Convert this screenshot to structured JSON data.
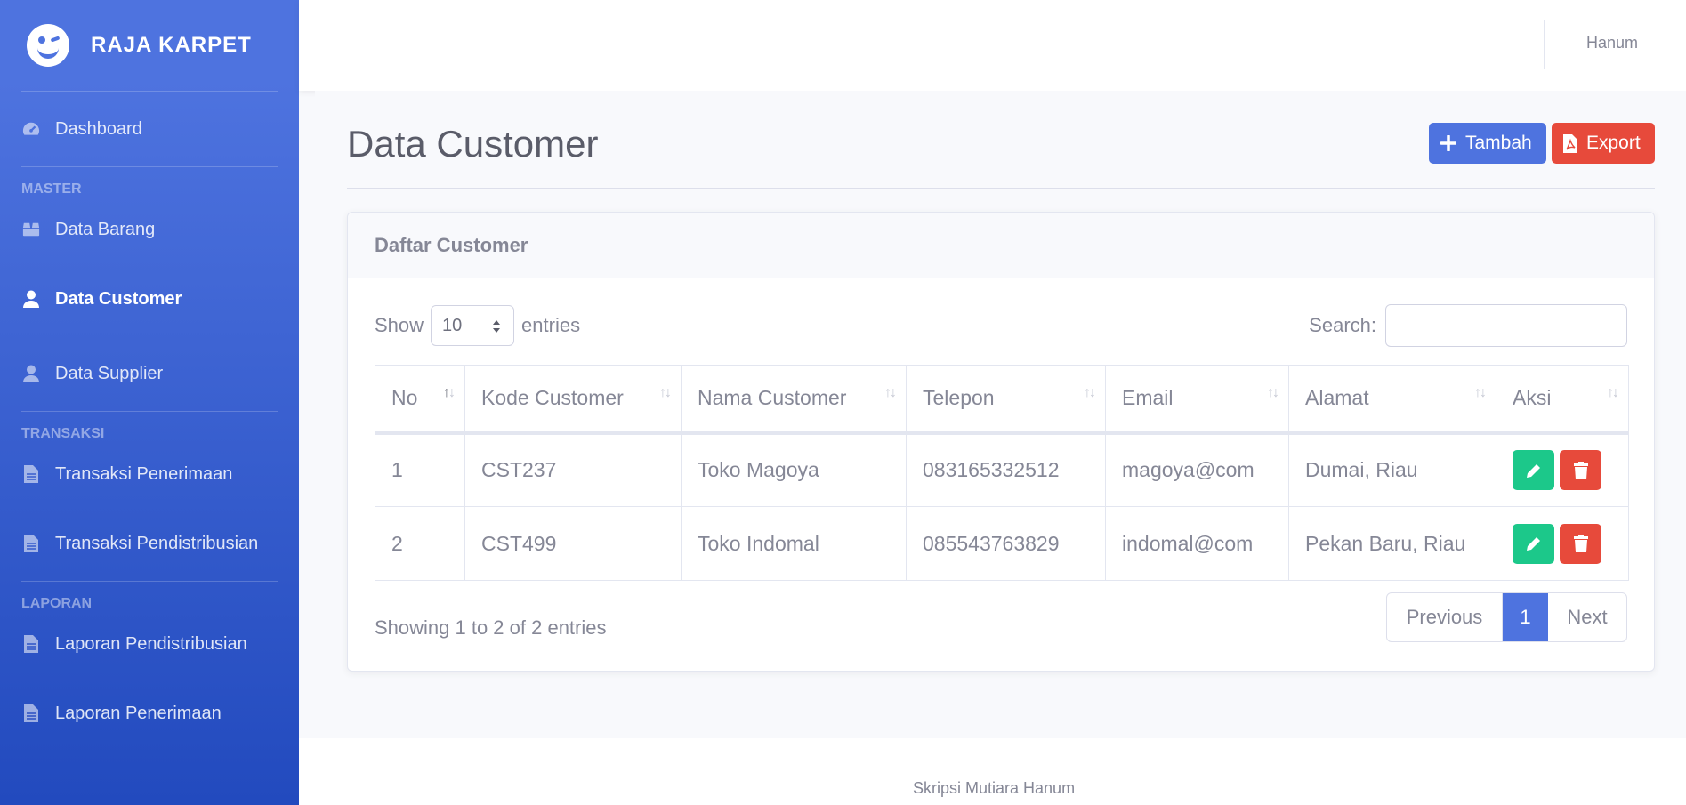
{
  "brand": {
    "name": "RAJA KARPET",
    "icon": "laugh-wink-icon"
  },
  "sidebar": {
    "dashboard": "Dashboard",
    "heading_master": "MASTER",
    "data_barang": "Data Barang",
    "data_customer": "Data Customer",
    "data_supplier": "Data Supplier",
    "heading_transaksi": "TRANSAKSI",
    "transaksi_penerimaan": "Transaksi Penerimaan",
    "transaksi_pendistribusian": "Transaksi Pendistribusian",
    "heading_laporan": "LAPORAN",
    "laporan_pendistribusian": "Laporan Pendistribusian",
    "laporan_penerimaan": "Laporan Penerimaan"
  },
  "topbar": {
    "user": "Hanum"
  },
  "page": {
    "title": "Data Customer",
    "btn_tambah": "Tambah",
    "btn_export": "Export"
  },
  "card": {
    "title": "Daftar Customer",
    "show_label": "Show",
    "entries_label": "entries",
    "length_value": "10",
    "search_label": "Search:",
    "search_value": ""
  },
  "table": {
    "headers": [
      "No",
      "Kode Customer",
      "Nama Customer",
      "Telepon",
      "Email",
      "Alamat",
      "Aksi"
    ],
    "rows": [
      [
        "1",
        "CST237",
        "Toko Magoya",
        "083165332512",
        "magoya@com",
        "Dumai, Riau"
      ],
      [
        "2",
        "CST499",
        "Toko Indomal",
        "085543763829",
        "indomal@com",
        "Pekan Baru, Riau"
      ]
    ]
  },
  "pagination": {
    "info": "Showing 1 to 2 of 2 entries",
    "previous": "Previous",
    "current": "1",
    "next": "Next"
  },
  "footer": {
    "text": "Skripsi Mutiara Hanum"
  },
  "colors": {
    "primary": "#4e73df",
    "danger": "#e74a3b",
    "success": "#1cc88a"
  }
}
